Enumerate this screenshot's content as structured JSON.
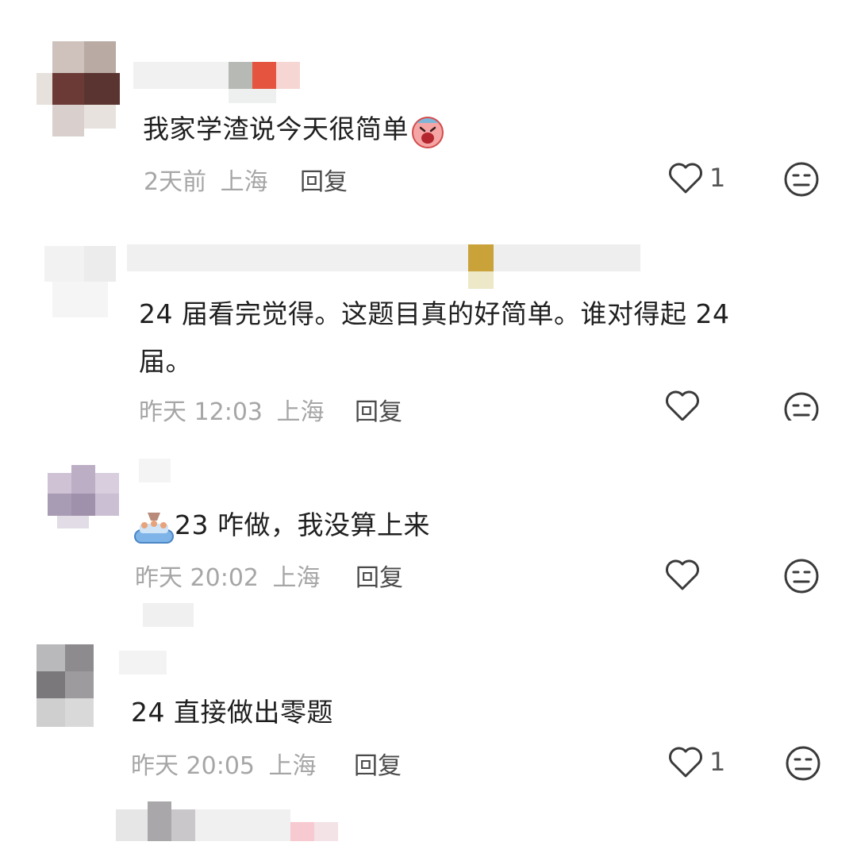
{
  "comments": [
    {
      "text": "我家学渣说今天很简单",
      "time": "2天前",
      "location": "上海",
      "reply_label": "回复",
      "like_count": "1",
      "emoji_prefix": "",
      "emoji_suffix": "crying-face-emoji"
    },
    {
      "text_line1": "24 届看完觉得。这题目真的好简单。谁对得起 24",
      "text_line2": "届。",
      "time": "昨天 12:03",
      "location": "上海",
      "reply_label": "回复",
      "like_count": ""
    },
    {
      "text": "23 咋做，我没算上来",
      "time": "昨天 20:02",
      "location": "上海",
      "reply_label": "回复",
      "like_count": "",
      "emoji_prefix": "sweating-pool-emoji"
    },
    {
      "text": "24 直接做出零题",
      "time": "昨天 20:05",
      "location": "上海",
      "reply_label": "回复",
      "like_count": "1"
    }
  ],
  "icons": {
    "like": "heart-outline-icon",
    "emoji": "neutral-face-icon"
  },
  "colors": {
    "text": "#1f1f1f",
    "meta": "#a6a6a6",
    "reply": "#4a4a4a",
    "icon": "#3a3a3a"
  }
}
